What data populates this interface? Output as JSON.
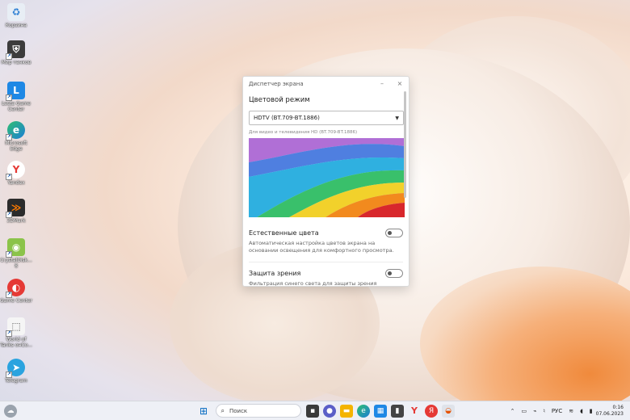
{
  "desktop": {
    "icons": [
      {
        "label": "Корзина",
        "icon": "recycle-bin-icon"
      },
      {
        "label": "Мир танков",
        "icon": "tank-game-icon"
      },
      {
        "label": "Lesta Game Center",
        "icon": "lesta-icon"
      },
      {
        "label": "Microsoft Edge",
        "icon": "edge-icon"
      },
      {
        "label": "Yandex",
        "icon": "yandex-browser-icon"
      },
      {
        "label": "3DMark",
        "icon": "3dmark-icon"
      },
      {
        "label": "CrystalDisk... 8",
        "icon": "crystaldisk-icon"
      },
      {
        "label": "Game Center",
        "icon": "game-center-icon"
      },
      {
        "label": "World of Tanks онCo...",
        "icon": "wot-icon"
      },
      {
        "label": "Telegram",
        "icon": "telegram-icon"
      }
    ]
  },
  "window": {
    "title": "Диспетчер экрана",
    "minimize_glyph": "–",
    "close_glyph": "×",
    "section_title": "Цветовой режим",
    "color_mode_value": "HDTV (BT.709-BT.1886)",
    "color_mode_hint": "Для видео и телевидения HD (BT.709-BT.1886)",
    "natural_colors": {
      "label": "Естественные цвета",
      "description": "Автоматическая настройка цветов экрана на основании освещения для комфортного просмотра.",
      "enabled": false
    },
    "eye_protection": {
      "label": "Защита зрения",
      "description": "Фильтрация синего света для защиты зрения",
      "enabled": false
    }
  },
  "taskbar": {
    "search_placeholder": "Поиск",
    "language": "РУС",
    "time": "0:16",
    "date": "07.06.2023"
  },
  "colors": {
    "taskbar_bg": "#eef0f6",
    "window_bg": "#ffffff",
    "accent": "#0067c0"
  }
}
